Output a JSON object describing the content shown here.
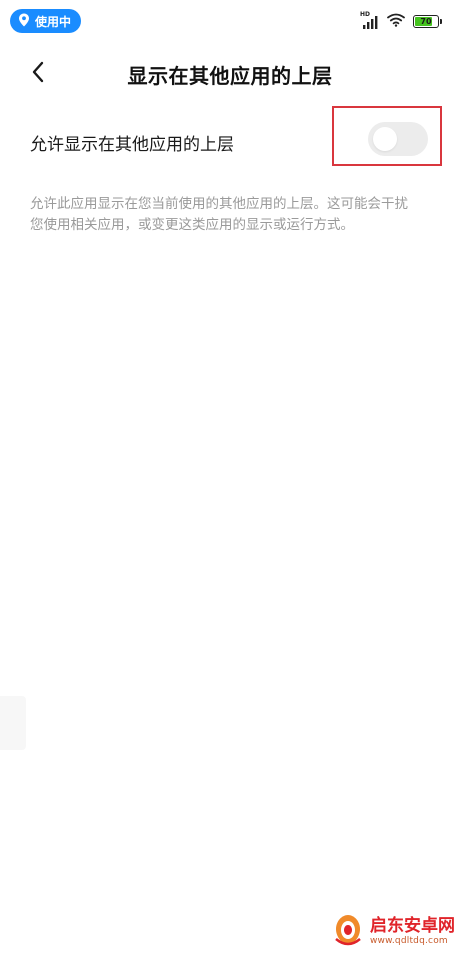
{
  "status_bar": {
    "location_pill_label": "使用中",
    "network_label": "HD",
    "battery_level": "70",
    "location_icon": "location-pin-icon",
    "signal_icon": "signal-icon",
    "wifi_icon": "wifi-icon",
    "colors": {
      "pill": "#1a8cff",
      "battery_fill": "#45c41f"
    }
  },
  "header": {
    "title": "显示在其他应用的上层",
    "back_icon": "chevron-left-icon"
  },
  "setting": {
    "label": "允许显示在其他应用的上层",
    "toggle_on": false,
    "highlight_color": "#d9363e"
  },
  "description": "允许此应用显示在您当前使用的其他应用的上层。这可能会干扰您使用相关应用，或变更这类应用的显示或运行方式。",
  "watermark": {
    "brand_text": "启东安卓网",
    "url_text": "www.qdltdq.com",
    "logo_icon": "watermark-logo-icon"
  }
}
